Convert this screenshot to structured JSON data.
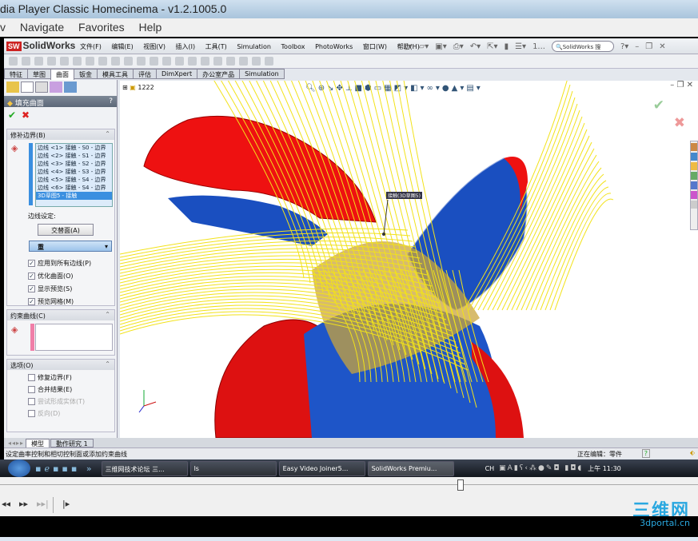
{
  "player": {
    "title": "dia Player Classic Homecinema - v1.2.1005.0",
    "menu": [
      "v",
      "Navigate",
      "Favorites",
      "Help"
    ],
    "watermark": "三维网",
    "watermark_url": "3dportal.cn"
  },
  "sw": {
    "logo": "SolidWorks",
    "logo_badge": "SW",
    "menu": [
      "文件(F)",
      "编辑(E)",
      "视图(V)",
      "插入(I)",
      "工具(T)",
      "Simulation",
      "Toolbox",
      "PhotoWorks",
      "窗口(W)",
      "帮助(H)"
    ],
    "search_placeholder": "SolidWorks 搜",
    "recent": "1...",
    "tabs": [
      "特征",
      "草图",
      "曲面",
      "钣金",
      "模具工具",
      "评估",
      "DimXpert",
      "办公室产品",
      "Simulation"
    ],
    "active_tab": "曲面",
    "tree_item": "1222",
    "panel": {
      "title": "填充曲面",
      "help": "?",
      "patch_section": "修补边界(B)",
      "edges": [
        "边线 <1> 接触 - S0 - 边界",
        "边线 <2> 接触 - S1 - 边界",
        "边线 <3> 接触 - S2 - 边界",
        "边线 <4> 接触 - S3 - 边界",
        "边线 <5> 接触 - S4 - 边界",
        "边线 <6> 接触 - S4 - 边界",
        "3D草图5 - 接触"
      ],
      "edge_settings": "边线设定:",
      "alternate_button": "交替面(A)",
      "dropdown_value": "重",
      "checks": [
        {
          "label": "应用到所有边线(P)",
          "checked": true
        },
        {
          "label": "优化曲面(O)",
          "checked": true
        },
        {
          "label": "显示预览(S)",
          "checked": true
        },
        {
          "label": "预览网格(M)",
          "checked": true
        }
      ],
      "constraint_section": "约束曲线(C)",
      "options_section": "选项(O)",
      "options": [
        {
          "label": "修复边界(F)",
          "checked": false,
          "enabled": true
        },
        {
          "label": "合并结果(E)",
          "checked": false,
          "enabled": true
        },
        {
          "label": "尝试形成实体(T)",
          "checked": false,
          "enabled": false
        },
        {
          "label": "反向(D)",
          "checked": false,
          "enabled": false
        }
      ]
    },
    "callout": "接触(3D草图5)",
    "bottom_tabs": [
      "模型",
      "動作研究 1"
    ],
    "status_text": "设定曲率控制和相切控制面或添加约束曲线",
    "status_right": "正在编辑：零件",
    "status_help": "?"
  },
  "taskbar": {
    "items": [
      "三维网技术论坛 三...",
      "ls",
      "Easy Video Joiner5...",
      "SolidWorks Premiu..."
    ],
    "lang": "CH",
    "clock": "上午 11:30"
  },
  "playback": {
    "position_fraction": 0.655
  }
}
